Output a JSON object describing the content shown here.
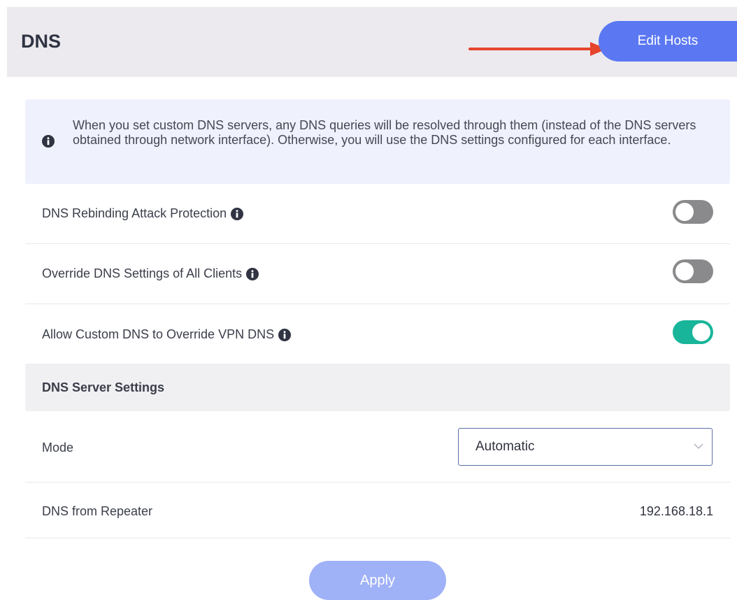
{
  "header": {
    "title": "DNS",
    "edit_hosts_label": "Edit Hosts",
    "arrow_color": "#e5452c"
  },
  "info": {
    "icon": "info-circle-icon",
    "text": "When you set custom DNS servers, any DNS queries will be resolved through them (instead of the DNS servers obtained through network interface). Otherwise, you will use the DNS settings configured for each interface."
  },
  "settings": [
    {
      "label": "DNS Rebinding Attack Protection",
      "enabled": false
    },
    {
      "label": "Override DNS Settings of All Clients",
      "enabled": false
    },
    {
      "label": "Allow Custom DNS to Override VPN DNS",
      "enabled": true
    }
  ],
  "server_settings": {
    "title": "DNS Server Settings",
    "mode_label": "Mode",
    "mode_value": "Automatic",
    "dns_from_label": "DNS from Repeater",
    "dns_from_value": "192.168.18.1"
  },
  "apply_label": "Apply",
  "colors": {
    "accent": "#5b78f2",
    "toggle_on": "#18b59a",
    "toggle_off": "#8a8a8d"
  }
}
